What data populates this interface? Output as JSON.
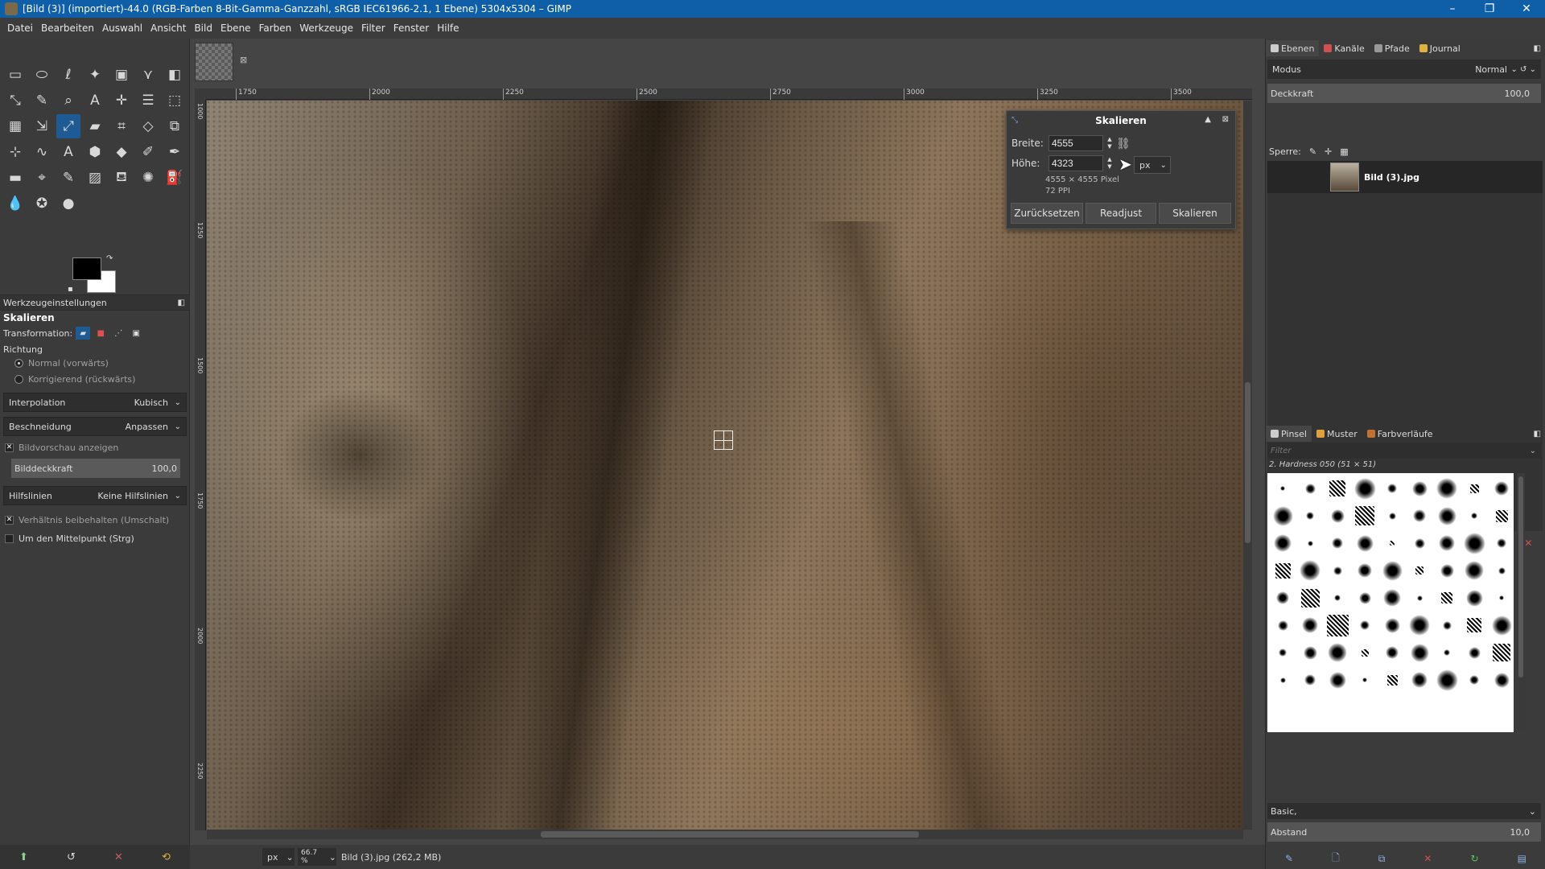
{
  "window": {
    "title": "[Bild (3)] (importiert)-44.0 (RGB-Farben 8-Bit-Gamma-Ganzzahl, sRGB IEC61966-2.1, 1 Ebene) 5304x5304 – GIMP",
    "controls": {
      "minimize": "–",
      "restore": "❐",
      "close": "✕"
    }
  },
  "menu": [
    "Datei",
    "Bearbeiten",
    "Auswahl",
    "Ansicht",
    "Bild",
    "Ebene",
    "Farben",
    "Werkzeuge",
    "Filter",
    "Fenster",
    "Hilfe"
  ],
  "toolbox": {
    "tools": [
      "▭",
      "⬭",
      "ℓ",
      "✦",
      "▣",
      "⋎",
      "◧",
      "⤡",
      "✎",
      "⌕",
      "A",
      "✛",
      "☰",
      "⬚",
      "▦",
      "⇲",
      "⤢",
      "▰",
      "⌗",
      "◇",
      "⧉",
      "⊹",
      "∿",
      "A",
      "⬢",
      "◆",
      "✐",
      "✒",
      "▬",
      "⌖",
      "✎",
      "▨",
      "⛾",
      "✺",
      "⛽",
      "💧",
      "✪",
      "●"
    ],
    "active_tool_index": 16,
    "colors": {
      "foreground": "#000000",
      "background": "#ffffff",
      "reset_icon": "▪",
      "swap_icon": "↷"
    }
  },
  "tool_options": {
    "header": "Werkzeugeinstellungen",
    "title": "Skalieren",
    "transformation_label": "Transformation:",
    "direction_label": "Richtung",
    "direction_normal": "Normal (vorwärts)",
    "direction_corrective": "Korrigierend (rückwärts)",
    "interpolation_label": "Interpolation",
    "interpolation_value": "Kubisch",
    "clipping_label": "Beschneidung",
    "clipping_value": "Anpassen",
    "show_preview": "Bildvorschau anzeigen",
    "image_opacity_label": "Bilddeckkraft",
    "image_opacity_value": "100,0",
    "guides_label": "Hilfslinien",
    "guides_value": "Keine Hilfslinien",
    "keep_aspect": "Verhältnis beibehalten (Umschalt)",
    "around_center": "Um den Mittelpunkt (Strg)"
  },
  "rulers": {
    "h_ticks": [
      "1750",
      "2000",
      "2250",
      "2500",
      "2750",
      "3000",
      "3250",
      "3500"
    ],
    "v_ticks": [
      "1000",
      "1250",
      "1500",
      "1750",
      "2000",
      "2250"
    ]
  },
  "image_tab": {
    "close": "⊠"
  },
  "status": {
    "unit": "px",
    "zoom": "66.7 %",
    "file": "Bild (3).jpg (262,2 MB)"
  },
  "scale_dialog": {
    "title": "Skalieren",
    "width_label": "Breite:",
    "width_value": "4555",
    "height_label": "Höhe:",
    "height_value": "4323",
    "unit": "px",
    "size_info": "4555 × 4555 Pixel",
    "ppi_info": "72 PPI",
    "reset": "Zurücksetzen",
    "readjust": "Readjust",
    "scale": "Skalieren"
  },
  "layers_dock": {
    "tabs": [
      "Ebenen",
      "Kanäle",
      "Pfade",
      "Journal"
    ],
    "mode_label": "Modus",
    "mode_value": "Normal",
    "opacity_label": "Deckkraft",
    "opacity_value": "100,0",
    "lock_label": "Sperre:",
    "layer_name": "Bild (3).jpg"
  },
  "brushes_dock": {
    "tabs": [
      "Pinsel",
      "Muster",
      "Farbverläufe"
    ],
    "filter_placeholder": "Filter",
    "selected_brush": "2. Hardness 050 (51 × 51)",
    "preset": "Basic,",
    "spacing_label": "Abstand",
    "spacing_value": "10,0"
  }
}
